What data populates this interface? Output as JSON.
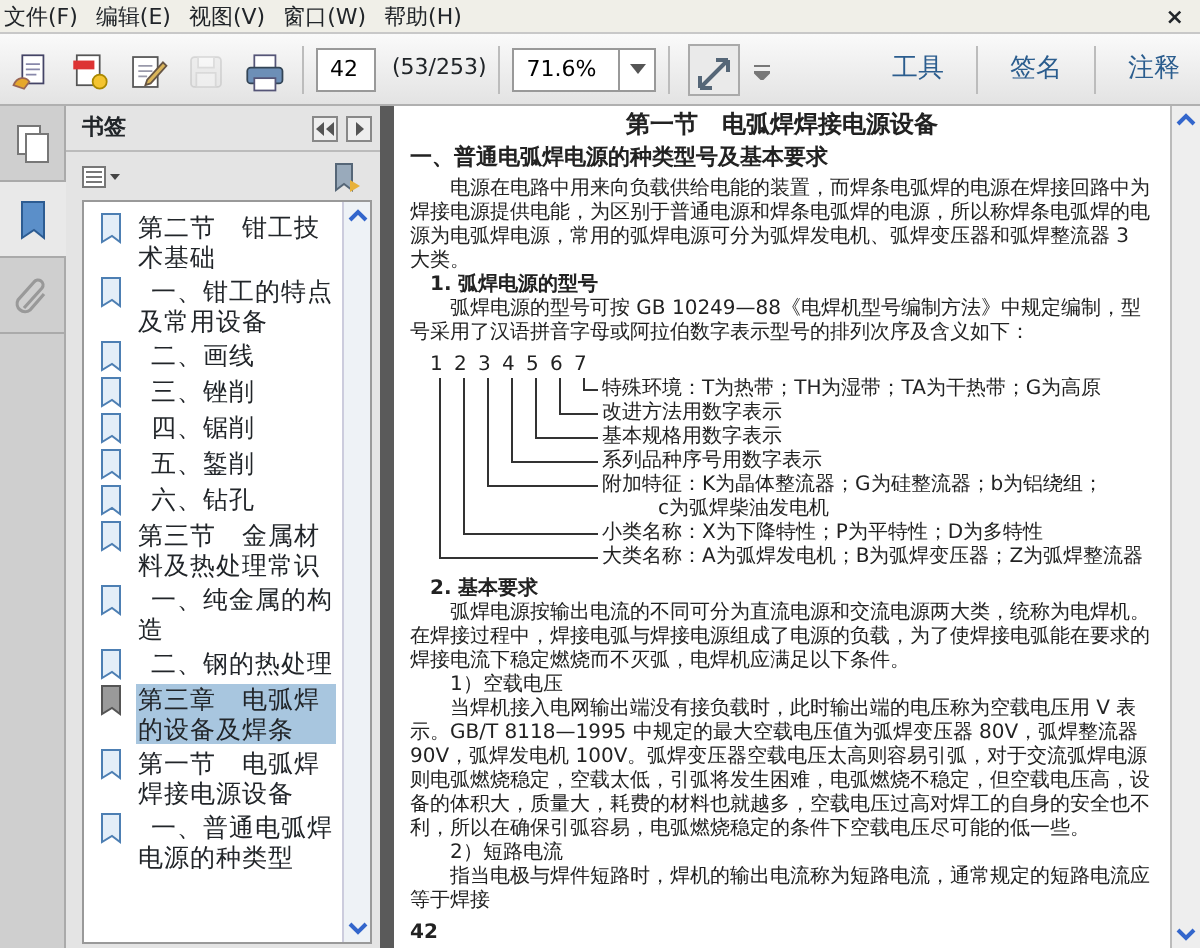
{
  "menu": [
    {
      "label": "文件(F)"
    },
    {
      "label": "编辑(E)"
    },
    {
      "label": "视图(V)"
    },
    {
      "label": "窗口(W)"
    },
    {
      "label": "帮助(H)"
    }
  ],
  "close_glyph": "×",
  "toolbar": {
    "buttons": [
      {
        "kind": "open",
        "disabled": false
      },
      {
        "kind": "create",
        "disabled": false
      },
      {
        "kind": "edit",
        "disabled": false
      },
      {
        "kind": "save",
        "disabled": true
      },
      {
        "kind": "print",
        "disabled": false
      }
    ],
    "page_field": {
      "value": "42"
    },
    "page_count": "(53/253)",
    "zoom_field": {
      "value": "71.6%"
    },
    "tasks": [
      {
        "label": "工具"
      },
      {
        "label": "签名"
      },
      {
        "label": "注释"
      }
    ]
  },
  "side_tabs": [
    {
      "kind": "pages",
      "selected": false
    },
    {
      "kind": "bookmarks",
      "selected": true
    },
    {
      "kind": "attachments",
      "selected": false
    }
  ],
  "bookmarks": {
    "title": "书签",
    "items": [
      {
        "label": "第二节　钳工技术基础",
        "selected": false,
        "children": [
          {
            "label": "一、钳工的特点及常用设备",
            "selected": false
          },
          {
            "label": "二、画线",
            "selected": false
          },
          {
            "label": "三、锉削",
            "selected": false
          },
          {
            "label": "四、锯削",
            "selected": false
          },
          {
            "label": "五、錾削",
            "selected": false
          },
          {
            "label": "六、钻孔",
            "selected": false
          }
        ]
      },
      {
        "label": "第三节　金属材料及热处理常识",
        "selected": false,
        "children": [
          {
            "label": "一、纯金属的构造",
            "selected": false
          },
          {
            "label": "二、钢的热处理",
            "selected": false
          }
        ]
      },
      {
        "label": "第三章　电弧焊的设备及焊条",
        "selected": true
      },
      {
        "label": "第一节　电弧焊焊接电源设备",
        "selected": false,
        "children": [
          {
            "label": "一、普通电弧焊电源的种类型",
            "selected": false
          }
        ]
      }
    ]
  },
  "document": {
    "blocks": [
      {
        "kind": "title",
        "text": "第一节　电弧焊焊接电源设备"
      },
      {
        "kind": "heading",
        "text": "一、普通电弧焊电源的种类型号及基本要求"
      },
      {
        "kind": "paragraph",
        "text": "电源在电路中用来向负载供给电能的装置，而焊条电弧焊的电源在焊接回路中为焊接电源提供电能，为区别于普通电源和焊条电弧焊的电源，所以称焊条电弧焊的电源为电弧焊电源，常用的弧焊电源可分为弧焊发电机、弧焊变压器和弧焊整流器 3 大类。"
      },
      {
        "kind": "subheading",
        "text": "1. 弧焊电源的型号"
      },
      {
        "kind": "paragraph",
        "text": "弧焊电源的型号可按 GB 10249—88《电焊机型号编制方法》中规定编制，型号采用了汉语拼音字母或阿拉伯数字表示型号的排列次序及含义如下："
      },
      {
        "kind": "diagram",
        "numbers": [
          "1",
          "2",
          "3",
          "4",
          "5",
          "6",
          "7"
        ],
        "labels": [
          {
            "lines": [
              "特殊环境：T为热带；TH为湿带；TA为干热带；G为高原"
            ]
          },
          {
            "lines": [
              "改进方法用数字表示"
            ]
          },
          {
            "lines": [
              "基本规格用数字表示"
            ]
          },
          {
            "lines": [
              "系列品种序号用数字表示"
            ]
          },
          {
            "lines": [
              "附加特征：K为晶体整流器；G为硅整流器；b为铝绕组；",
              "c为弧焊柴油发电机"
            ]
          },
          {
            "lines": [
              "小类名称：X为下降特性；P为平特性；D为多特性"
            ]
          },
          {
            "lines": [
              "大类名称：A为弧焊发电机；B为弧焊变压器；Z为弧焊整流器"
            ]
          }
        ]
      },
      {
        "kind": "subheading",
        "text": "2. 基本要求"
      },
      {
        "kind": "paragraph",
        "text": "弧焊电源按输出电流的不同可分为直流电源和交流电源两大类，统称为电焊机。在焊接过程中，焊接电弧与焊接电源组成了电源的负载，为了使焊接电弧能在要求的焊接电流下稳定燃烧而不灭弧，电焊机应满足以下条件。"
      },
      {
        "kind": "item",
        "text": "1）空载电压"
      },
      {
        "kind": "paragraph",
        "text": "当焊机接入电网输出端没有接负载时，此时输出端的电压称为空载电压用 V 表示。GB/T 8118—1995 中规定的最大空载电压值为弧焊变压器 80V，弧焊整流器 90V，弧焊发电机 100V。弧焊变压器空载电压太高则容易引弧，对于交流弧焊电源则电弧燃烧稳定，空载太低，引弧将发生困难，电弧燃烧不稳定，但空载电压高，设备的体积大，质量大，耗费的材料也就越多，空载电压过高对焊工的自身的安全也不利，所以在确保引弧容易，电弧燃烧稳定的条件下空载电压尽可能的低一些。"
      },
      {
        "kind": "item",
        "text": "2）短路电流"
      },
      {
        "kind": "paragraph",
        "text": "指当电极与焊件短路时，焊机的输出电流称为短路电流，通常规定的短路电流应等于焊接"
      },
      {
        "kind": "page_number",
        "text": "42"
      }
    ]
  }
}
